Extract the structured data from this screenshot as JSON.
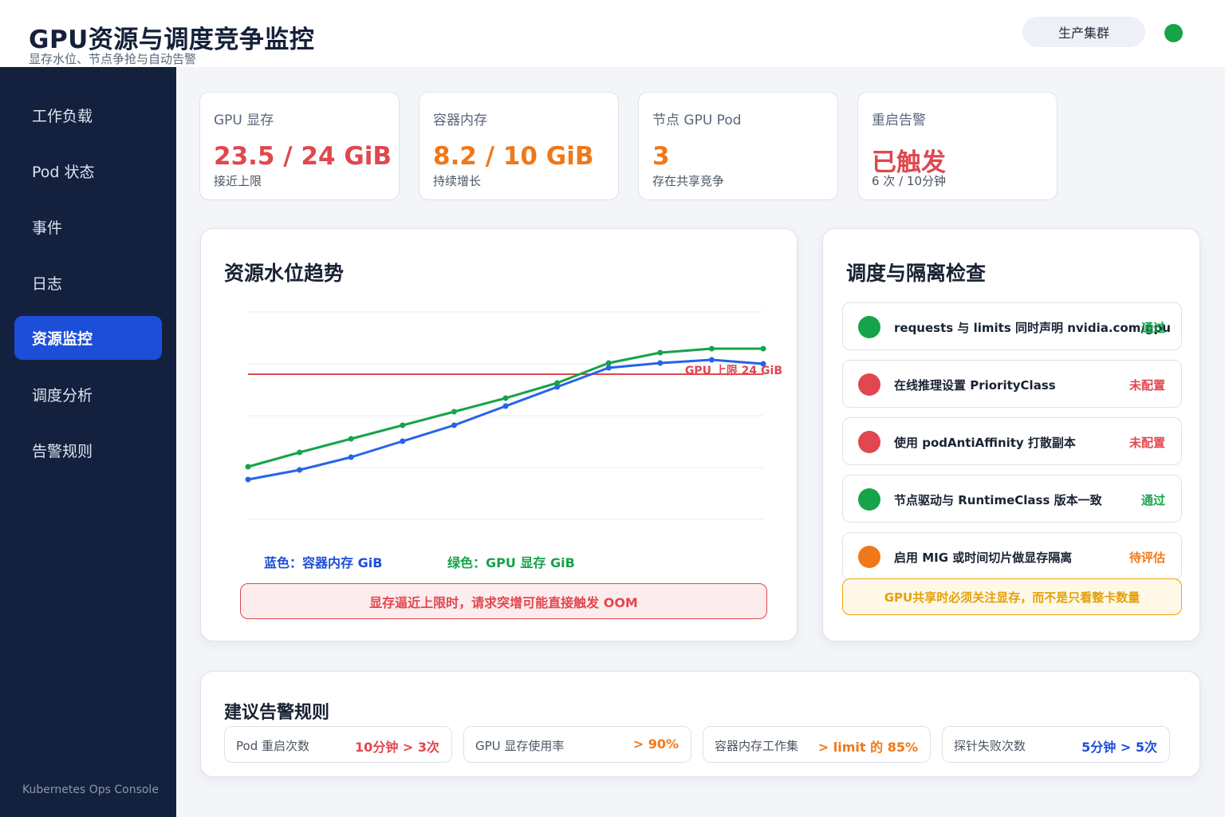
{
  "header": {
    "title": "GPU资源与调度竞争监控",
    "subtitle": "显存水位、节点争抢与自动告警",
    "cluster": "生产集群",
    "status_color": "#16a34a"
  },
  "sidebar": {
    "items": [
      {
        "label": "工作负载",
        "active": false
      },
      {
        "label": "Pod 状态",
        "active": false
      },
      {
        "label": "事件",
        "active": false
      },
      {
        "label": "日志",
        "active": false
      },
      {
        "label": "资源监控",
        "active": true
      },
      {
        "label": "调度分析",
        "active": false
      },
      {
        "label": "告警规则",
        "active": false
      }
    ],
    "footer": "Kubernetes Ops Console"
  },
  "kpis": [
    {
      "label": "GPU 显存",
      "value": "23.5 / 24 GiB",
      "note": "接近上限",
      "color": "#e0474f"
    },
    {
      "label": "容器内存",
      "value": "8.2 / 10 GiB",
      "note": "持续增长",
      "color": "#f07819"
    },
    {
      "label": "节点 GPU Pod",
      "value": "3",
      "note": "存在共享竞争",
      "color": "#f07819"
    },
    {
      "label": "重启告警",
      "value": "已触发",
      "note": "6 次 / 10分钟",
      "color": "#e0474f"
    }
  ],
  "chart_panel": {
    "title": "资源水位趋势",
    "legend_blue": "蓝色：容器内存 GiB",
    "legend_green": "绿色：GPU 显存 GiB",
    "alert": "显存逼近上限时，请求突增可能直接触发 OOM"
  },
  "chart_data": {
    "type": "line",
    "title": "资源水位趋势",
    "x": [
      1,
      2,
      3,
      4,
      5,
      6,
      7,
      8,
      9,
      10,
      11
    ],
    "ylim": [
      0,
      26
    ],
    "grid": true,
    "series": [
      {
        "name": "容器内存 GiB",
        "color": "#2563eb",
        "values": [
          5.0,
          6.2,
          7.8,
          9.8,
          11.8,
          14.2,
          16.6,
          19.0,
          19.6,
          20.0,
          19.5
        ]
      },
      {
        "name": "GPU 显存 GiB",
        "color": "#16a34a",
        "values": [
          6.6,
          8.4,
          10.1,
          11.8,
          13.5,
          15.2,
          17.1,
          19.6,
          20.9,
          21.4,
          21.4
        ]
      }
    ],
    "threshold": {
      "label": "GPU 上限 24 GiB",
      "value": 18.2,
      "color": "#e0474f"
    }
  },
  "checks_panel": {
    "title": "调度与隔离检查",
    "items": [
      {
        "label": "requests 与 limits 同时声明 nvidia.com/gpu",
        "status": "通过",
        "color": "#16a34a"
      },
      {
        "label": "在线推理设置 PriorityClass",
        "status": "未配置",
        "color": "#e0474f"
      },
      {
        "label": "使用 podAntiAffinity 打散副本",
        "status": "未配置",
        "color": "#e0474f"
      },
      {
        "label": "节点驱动与 RuntimeClass 版本一致",
        "status": "通过",
        "color": "#16a34a"
      },
      {
        "label": "启用 MIG 或时间切片做显存隔离",
        "status": "待评估",
        "color": "#f07819"
      }
    ],
    "note": "GPU共享时必须关注显存，而不是只看整卡数量"
  },
  "rules_panel": {
    "title": "建议告警规则",
    "items": [
      {
        "name": "Pod 重启次数",
        "value": "10分钟 > 3次",
        "color": "#e0474f"
      },
      {
        "name": "GPU 显存使用率",
        "value": "> 90%",
        "color": "#f07819"
      },
      {
        "name": "容器内存工作集",
        "value": "> limit 的 85%",
        "color": "#f07819"
      },
      {
        "name": "探针失败次数",
        "value": "5分钟 > 5次",
        "color": "#1d4ed8"
      }
    ]
  }
}
